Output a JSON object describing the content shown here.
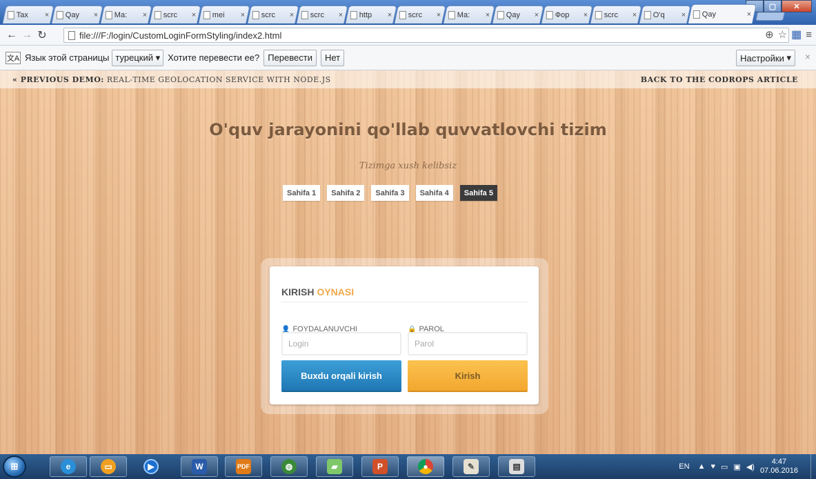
{
  "browser": {
    "tabs": [
      {
        "label": "Tax"
      },
      {
        "label": "Qay"
      },
      {
        "label": "Ma:"
      },
      {
        "label": "scrc"
      },
      {
        "label": "mei"
      },
      {
        "label": "scrc"
      },
      {
        "label": "scrc"
      },
      {
        "label": "http"
      },
      {
        "label": "scrc"
      },
      {
        "label": "Ma:"
      },
      {
        "label": "Qay"
      },
      {
        "label": "Фор"
      },
      {
        "label": "scrc"
      },
      {
        "label": "O'q"
      },
      {
        "label": "Qay"
      }
    ],
    "tab_close_glyph": "×",
    "url": "file:///F:/login/CustomLoginFormStyling/index2.html"
  },
  "translate_bar": {
    "label": "Язык этой страницы",
    "language": "турецкий",
    "question": "Хотите перевести ее?",
    "translate_button": "Перевести",
    "no_button": "Нет",
    "settings_button": "Настройки"
  },
  "page": {
    "prev_demo_label": "« PREVIOUS DEMO:",
    "prev_demo_title": "REAL-TIME GEOLOCATION SERVICE WITH NODE.JS",
    "back_link": "BACK TO THE CODROPS ARTICLE",
    "title": "O'quv jarayonini qo'llab quvvatlovchi tizim",
    "subtitle": "Tizimga xush kelibsiz",
    "nav": [
      {
        "label": "Sahifa 1"
      },
      {
        "label": "Sahifa 2"
      },
      {
        "label": "Sahifa 3"
      },
      {
        "label": "Sahifa 4"
      },
      {
        "label": "Sahifa 5"
      }
    ],
    "form": {
      "heading": "KIRISH",
      "heading_accent": "OYNASI",
      "username_label": "FOYDALANUVCHI",
      "password_label": "PAROL",
      "username_placeholder": "Login",
      "password_placeholder": "Parol",
      "barcode_button": "Buxdu orqali kirish",
      "login_button": "Kirish"
    }
  },
  "taskbar": {
    "language": "EN",
    "time": "4:47",
    "date": "07.06.2016"
  },
  "colors": {
    "accent_orange": "#f0a94a",
    "button_blue": "#1f77b4",
    "active_nav": "#3b3b3b"
  }
}
